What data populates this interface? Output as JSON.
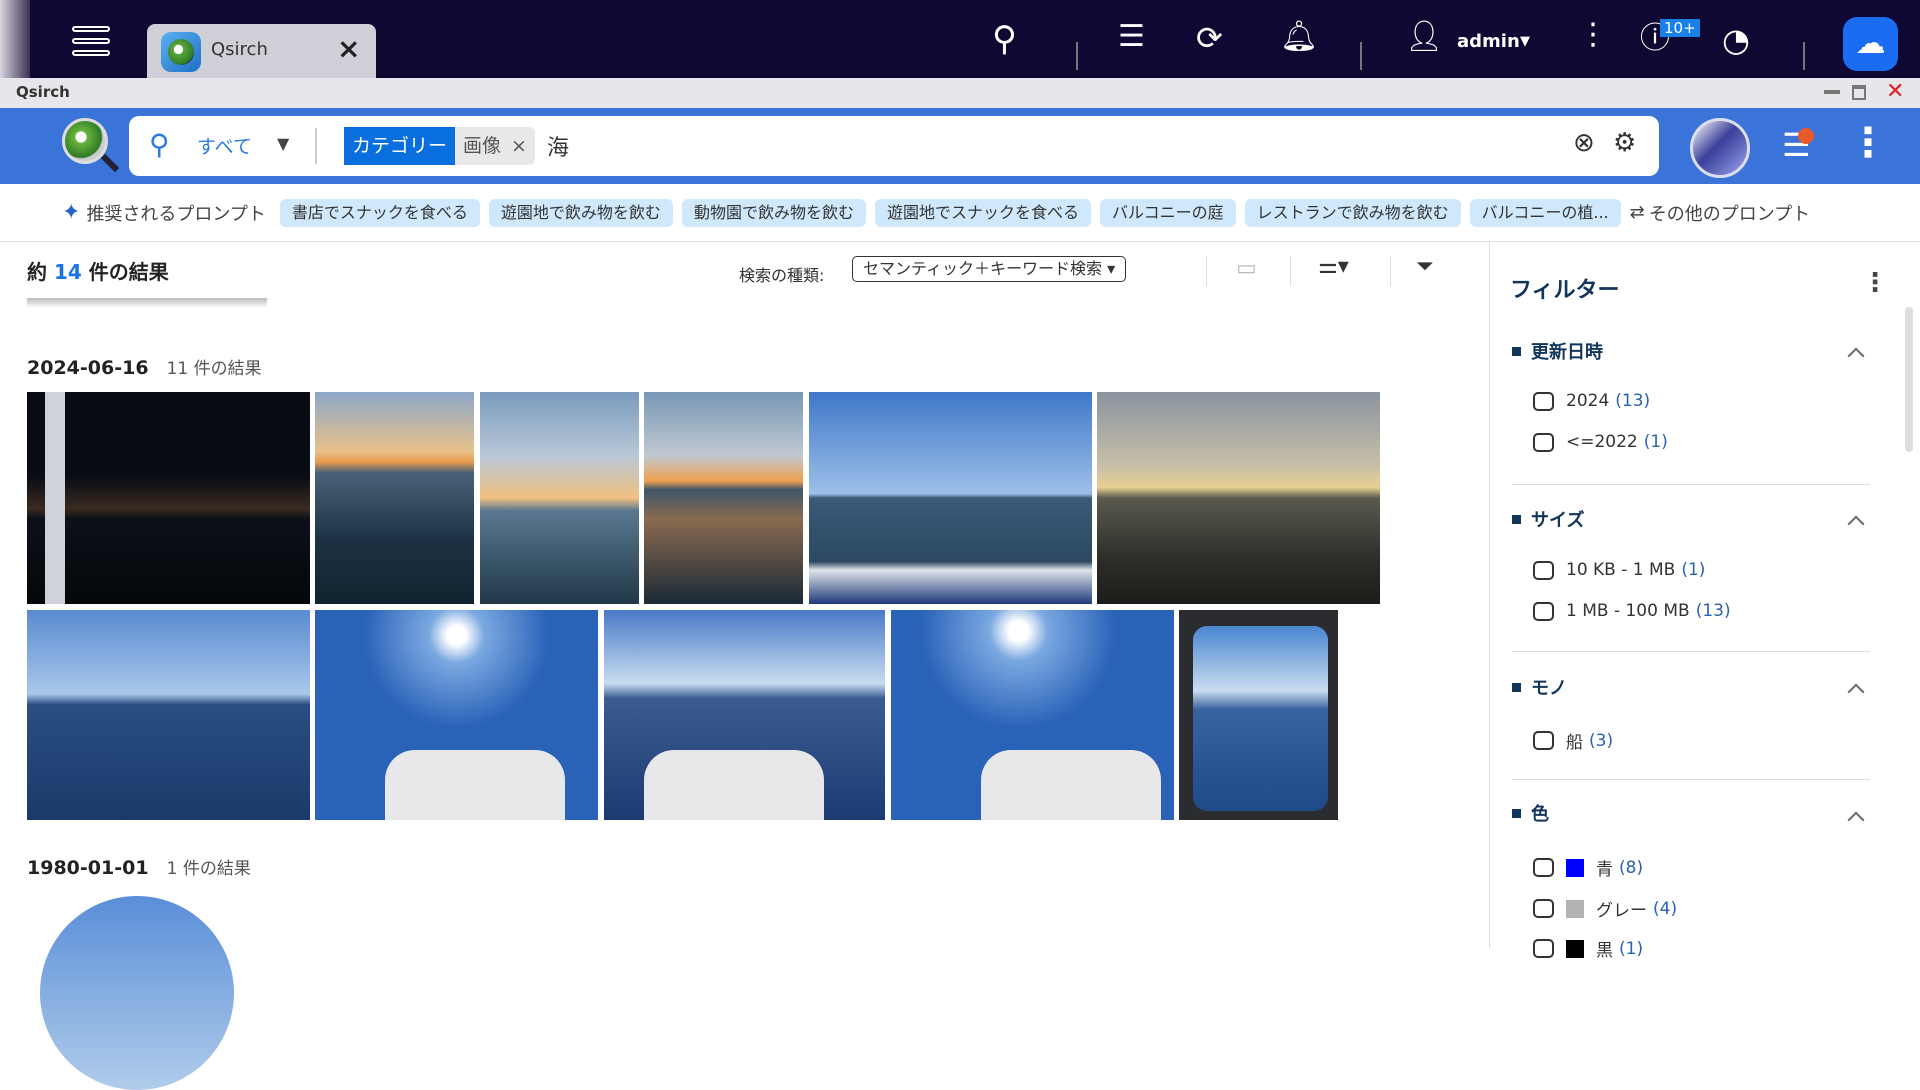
{
  "topbar": {
    "tab_title": "Qsirch",
    "user": "admin",
    "badge": "10+"
  },
  "window": {
    "title": "Qsirch"
  },
  "search": {
    "scope": "すべて",
    "chip_category": "カテゴリー",
    "chip_value": "画像",
    "query": "海"
  },
  "prompts": {
    "label": "推奨されるプロンプト",
    "items": [
      "書店でスナックを食べる",
      "遊園地で飲み物を飲む",
      "動物園で飲み物を飲む",
      "遊園地でスナックを食べる",
      "バルコニーの庭",
      "レストランで飲み物を飲む",
      "バルコニーの植..."
    ],
    "more": "その他のプロンプト"
  },
  "results": {
    "prefix": "約",
    "count": "14",
    "suffix": "件の結果",
    "search_type_label": "検索の種類:",
    "search_type": "セマンティック＋キーワード検索",
    "groups": [
      {
        "date": "2024-06-16",
        "count": "11 件の結果"
      },
      {
        "date": "1980-01-01",
        "count": "1 件の結果"
      }
    ]
  },
  "filter": {
    "title": "フィルター",
    "sections": [
      {
        "title": "更新日時",
        "items": [
          {
            "label": "2024",
            "count": "(13)"
          },
          {
            "label": "<=2022",
            "count": "(1)"
          }
        ]
      },
      {
        "title": "サイズ",
        "items": [
          {
            "label": "10 KB - 1 MB",
            "count": "(1)"
          },
          {
            "label": "1 MB - 100 MB",
            "count": "(13)"
          }
        ]
      },
      {
        "title": "モノ",
        "items": [
          {
            "label": "船",
            "count": "(3)"
          }
        ]
      },
      {
        "title": "色",
        "items": [
          {
            "label": "青",
            "count": "(8)",
            "color": "#0000ff"
          },
          {
            "label": "グレー",
            "count": "(4)",
            "color": "#b3b3b3"
          },
          {
            "label": "黒",
            "count": "(1)",
            "color": "#000000"
          }
        ]
      }
    ]
  }
}
